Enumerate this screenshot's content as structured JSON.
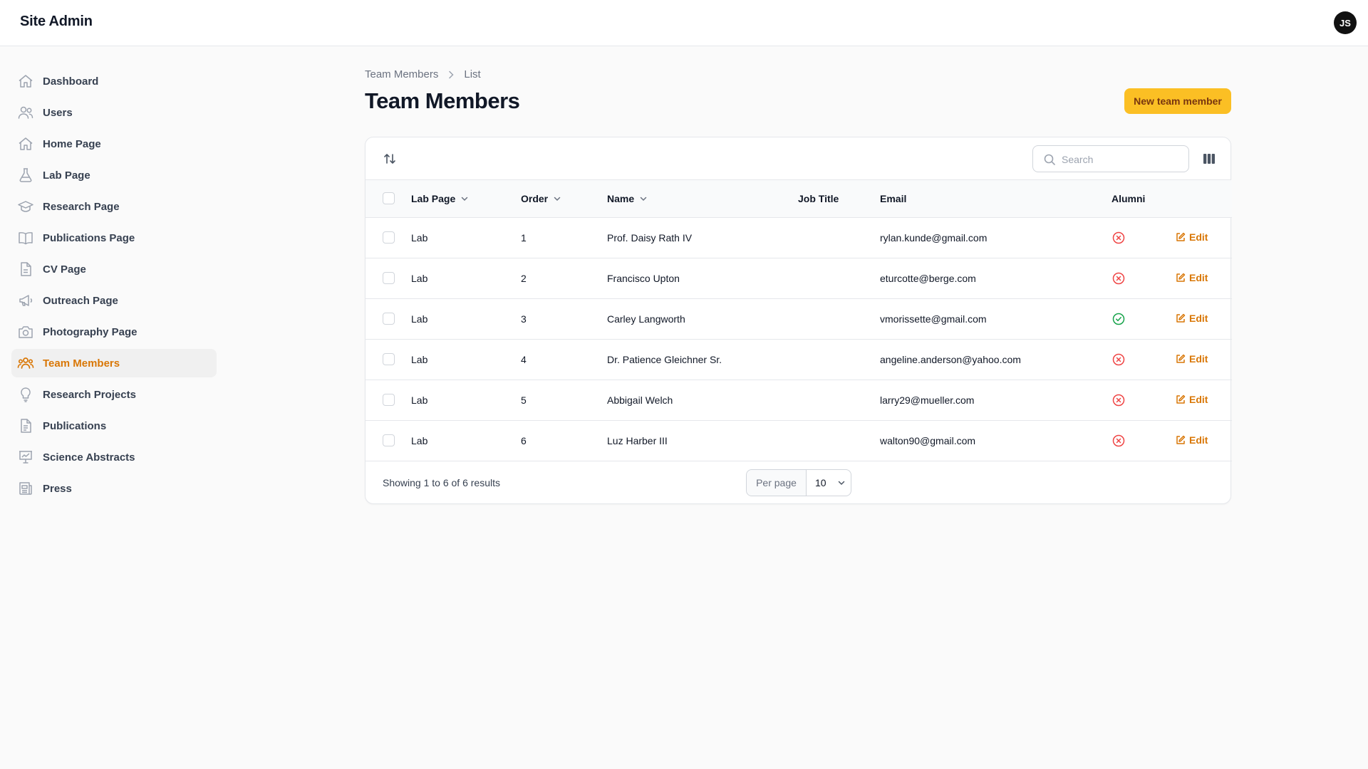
{
  "app": {
    "title": "Site Admin",
    "user_initials": "JS"
  },
  "sidebar": {
    "items": [
      {
        "label": "Dashboard",
        "icon": "home-icon"
      },
      {
        "label": "Users",
        "icon": "users-icon"
      },
      {
        "label": "Home Page",
        "icon": "home-icon"
      },
      {
        "label": "Lab Page",
        "icon": "beaker-icon"
      },
      {
        "label": "Research Page",
        "icon": "academic-cap-icon"
      },
      {
        "label": "Publications Page",
        "icon": "book-open-icon"
      },
      {
        "label": "CV Page",
        "icon": "document-icon"
      },
      {
        "label": "Outreach Page",
        "icon": "megaphone-icon"
      },
      {
        "label": "Photography Page",
        "icon": "camera-icon"
      },
      {
        "label": "Team Members",
        "icon": "user-group-icon",
        "active": true
      },
      {
        "label": "Research Projects",
        "icon": "light-bulb-icon"
      },
      {
        "label": "Publications",
        "icon": "document-text-icon"
      },
      {
        "label": "Science Abstracts",
        "icon": "presentation-chart-icon"
      },
      {
        "label": "Press",
        "icon": "newspaper-icon"
      }
    ]
  },
  "breadcrumb": {
    "parent": "Team Members",
    "current": "List"
  },
  "page": {
    "title": "Team Members",
    "new_button": "New team member"
  },
  "table": {
    "search_placeholder": "Search",
    "columns": {
      "lab_page": "Lab Page",
      "order": "Order",
      "name": "Name",
      "job_title": "Job Title",
      "email": "Email",
      "alumni": "Alumni"
    },
    "edit_label": "Edit",
    "rows": [
      {
        "lab_page": "Lab",
        "order": "1",
        "name": "Prof. Daisy Rath IV",
        "job_title": "",
        "email": "rylan.kunde@gmail.com",
        "alumni": false
      },
      {
        "lab_page": "Lab",
        "order": "2",
        "name": "Francisco Upton",
        "job_title": "",
        "email": "eturcotte@berge.com",
        "alumni": false
      },
      {
        "lab_page": "Lab",
        "order": "3",
        "name": "Carley Langworth",
        "job_title": "",
        "email": "vmorissette@gmail.com",
        "alumni": true
      },
      {
        "lab_page": "Lab",
        "order": "4",
        "name": "Dr. Patience Gleichner Sr.",
        "job_title": "",
        "email": "angeline.anderson@yahoo.com",
        "alumni": false
      },
      {
        "lab_page": "Lab",
        "order": "5",
        "name": "Abbigail Welch",
        "job_title": "",
        "email": "larry29@mueller.com",
        "alumni": false
      },
      {
        "lab_page": "Lab",
        "order": "6",
        "name": "Luz Harber III",
        "job_title": "",
        "email": "walton90@gmail.com",
        "alumni": false
      }
    ],
    "footer": {
      "results_text": "Showing 1 to 6 of 6 results",
      "per_page_label": "Per page",
      "per_page_value": "10"
    }
  },
  "colors": {
    "accent": "#d97706",
    "primary_button": "#fbbf24",
    "alumni_yes": "#16a34a",
    "alumni_no": "#ef4444"
  }
}
